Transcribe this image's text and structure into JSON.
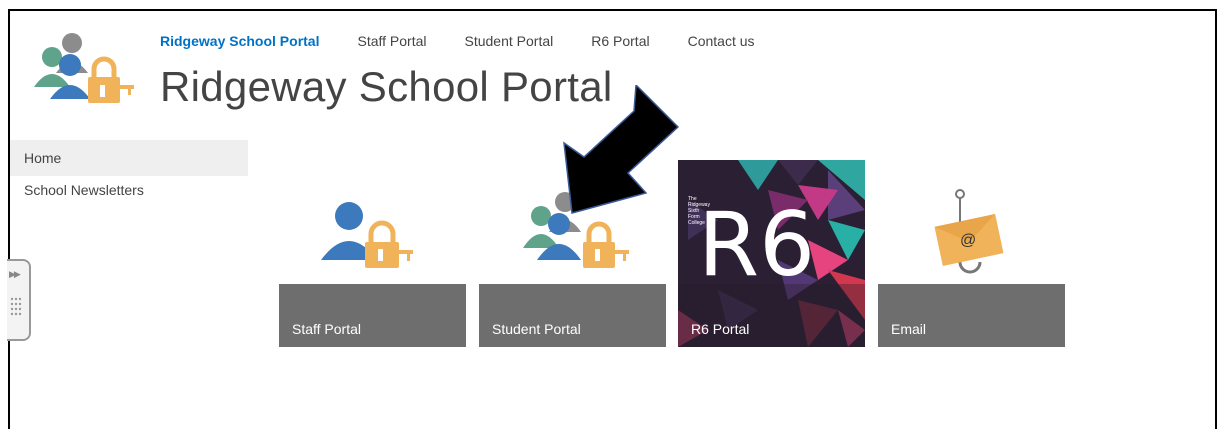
{
  "site": {
    "title": "Ridgeway School Portal"
  },
  "topnav": {
    "items": [
      {
        "label": "Ridgeway School Portal",
        "active": true
      },
      {
        "label": "Staff Portal",
        "active": false
      },
      {
        "label": "Student Portal",
        "active": false
      },
      {
        "label": "R6 Portal",
        "active": false
      },
      {
        "label": "Contact us",
        "active": false
      }
    ]
  },
  "quicklaunch": {
    "items": [
      {
        "label": "Home",
        "selected": true
      },
      {
        "label": "School Newsletters",
        "selected": false
      }
    ]
  },
  "tiles": [
    {
      "label": "Staff Portal",
      "icon": "staff-lock-icon"
    },
    {
      "label": "Student Portal",
      "icon": "students-lock-icon"
    },
    {
      "label": "R6 Portal",
      "icon": "r6-logo",
      "logo_text": "R6",
      "logo_caption": "The Ridgeway Sixth Form College"
    },
    {
      "label": "Email",
      "icon": "envelope-hook-icon"
    }
  ],
  "colors": {
    "nav_active": "#0072c6",
    "tile_bar": "#6e6e6e",
    "person_blue": "#3c79bd",
    "person_green": "#5fa38a",
    "person_gray": "#8c8c8c",
    "lock_gold": "#f0b35a"
  }
}
